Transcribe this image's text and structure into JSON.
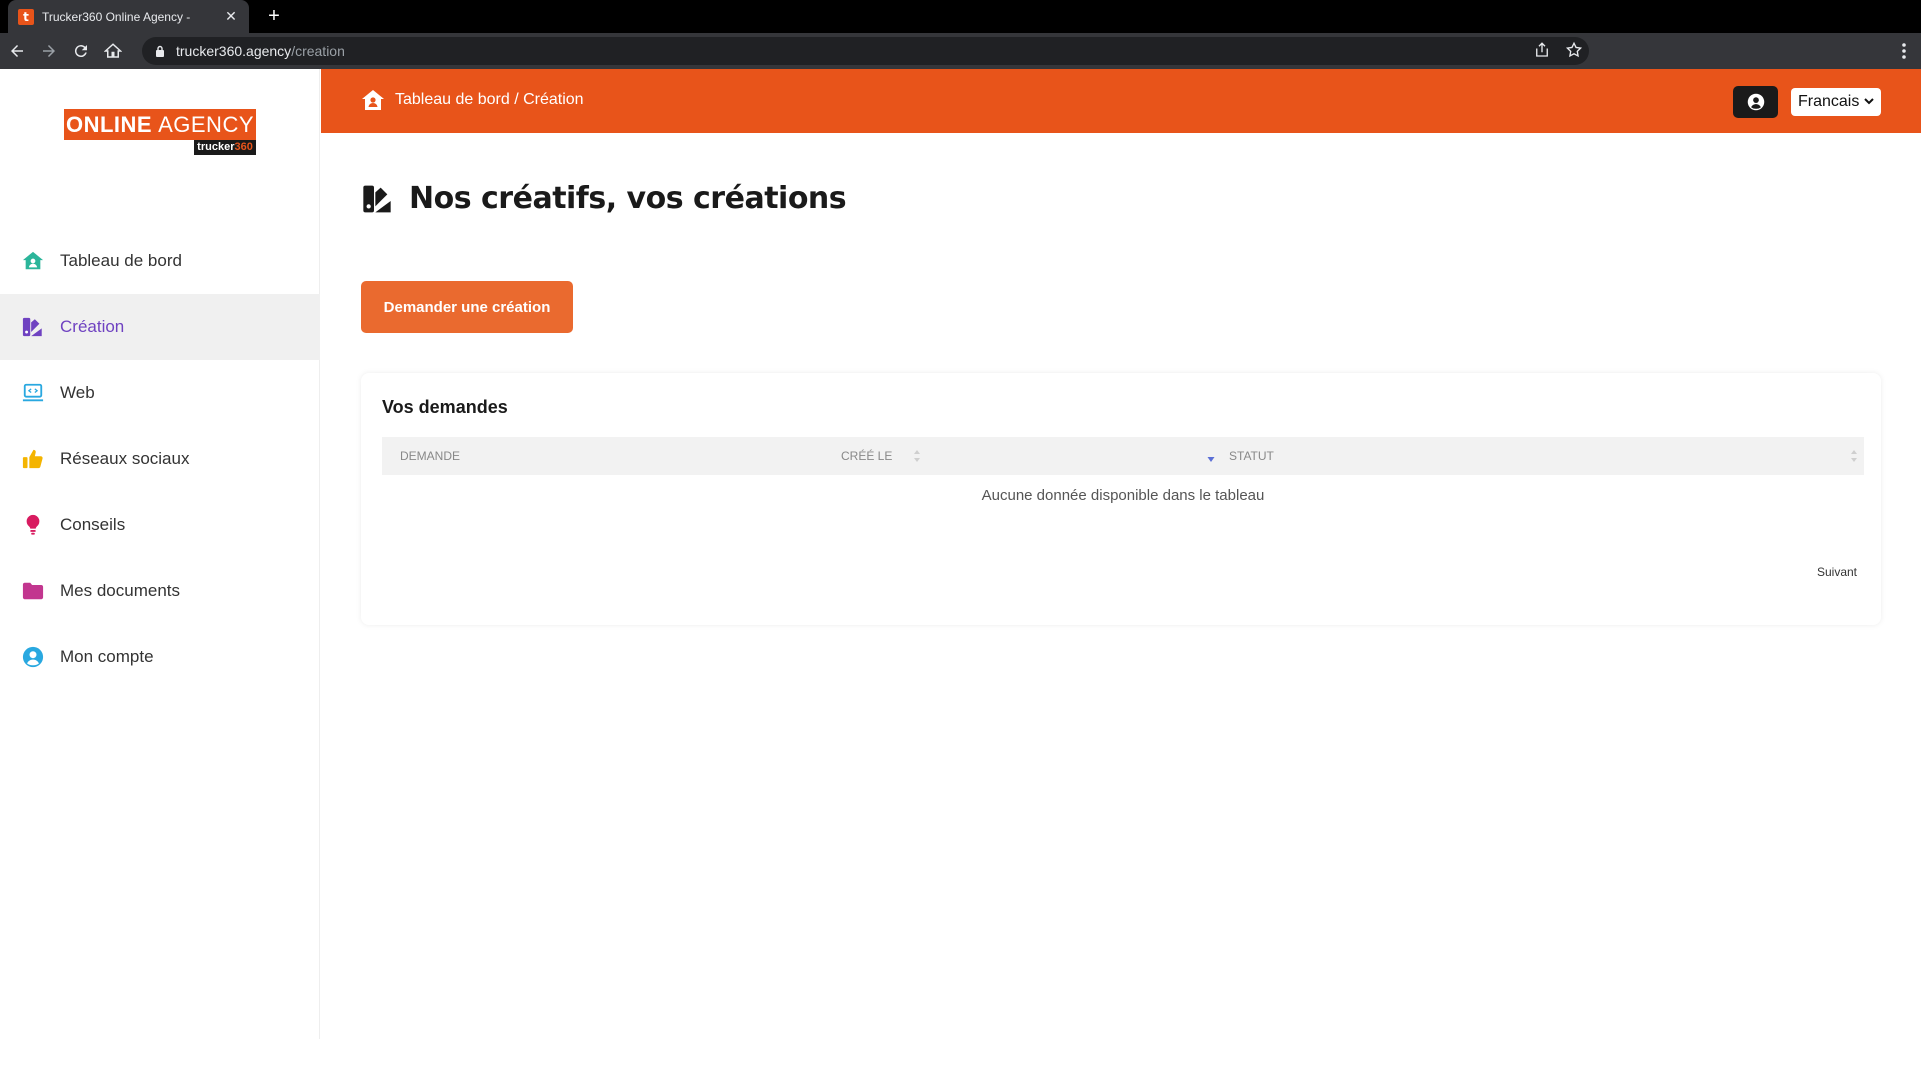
{
  "browser": {
    "tab_title": "Trucker360 Online Agency -",
    "tab_favicon_letter": "t",
    "url_host": "trucker360.agency",
    "url_path": "/creation"
  },
  "logo": {
    "main_bold": "ONLINE",
    "main_thin": "AGENCY",
    "sub_text": "trucker",
    "sub_num": "360"
  },
  "sidebar": {
    "items": [
      {
        "label": "Tableau de bord",
        "icon": "home-icon",
        "color": "#2bb59a"
      },
      {
        "label": "Création",
        "icon": "swatch-icon",
        "color": "#6f42c1",
        "active": true
      },
      {
        "label": "Web",
        "icon": "laptop-code-icon",
        "color": "#29a8e0"
      },
      {
        "label": "Réseaux sociaux",
        "icon": "thumbs-up-icon",
        "color": "#f4b400"
      },
      {
        "label": "Conseils",
        "icon": "lightbulb-icon",
        "color": "#d81b60"
      },
      {
        "label": "Mes documents",
        "icon": "folder-icon",
        "color": "#c2368f"
      },
      {
        "label": "Mon compte",
        "icon": "user-circle-icon",
        "color": "#29a8e0"
      }
    ]
  },
  "topbar": {
    "breadcrumb": "Tableau de bord / Création",
    "language": "Francais",
    "accent": "#e8541a"
  },
  "main": {
    "title": "Nos créatifs, vos créations",
    "cta_label": "Demander une création",
    "card_title": "Vos demandes",
    "columns": [
      "DEMANDE",
      "CRÉÉ LE",
      "STATUT"
    ],
    "empty_message": "Aucune donnée disponible dans le tableau",
    "next_label": "Suivant"
  }
}
